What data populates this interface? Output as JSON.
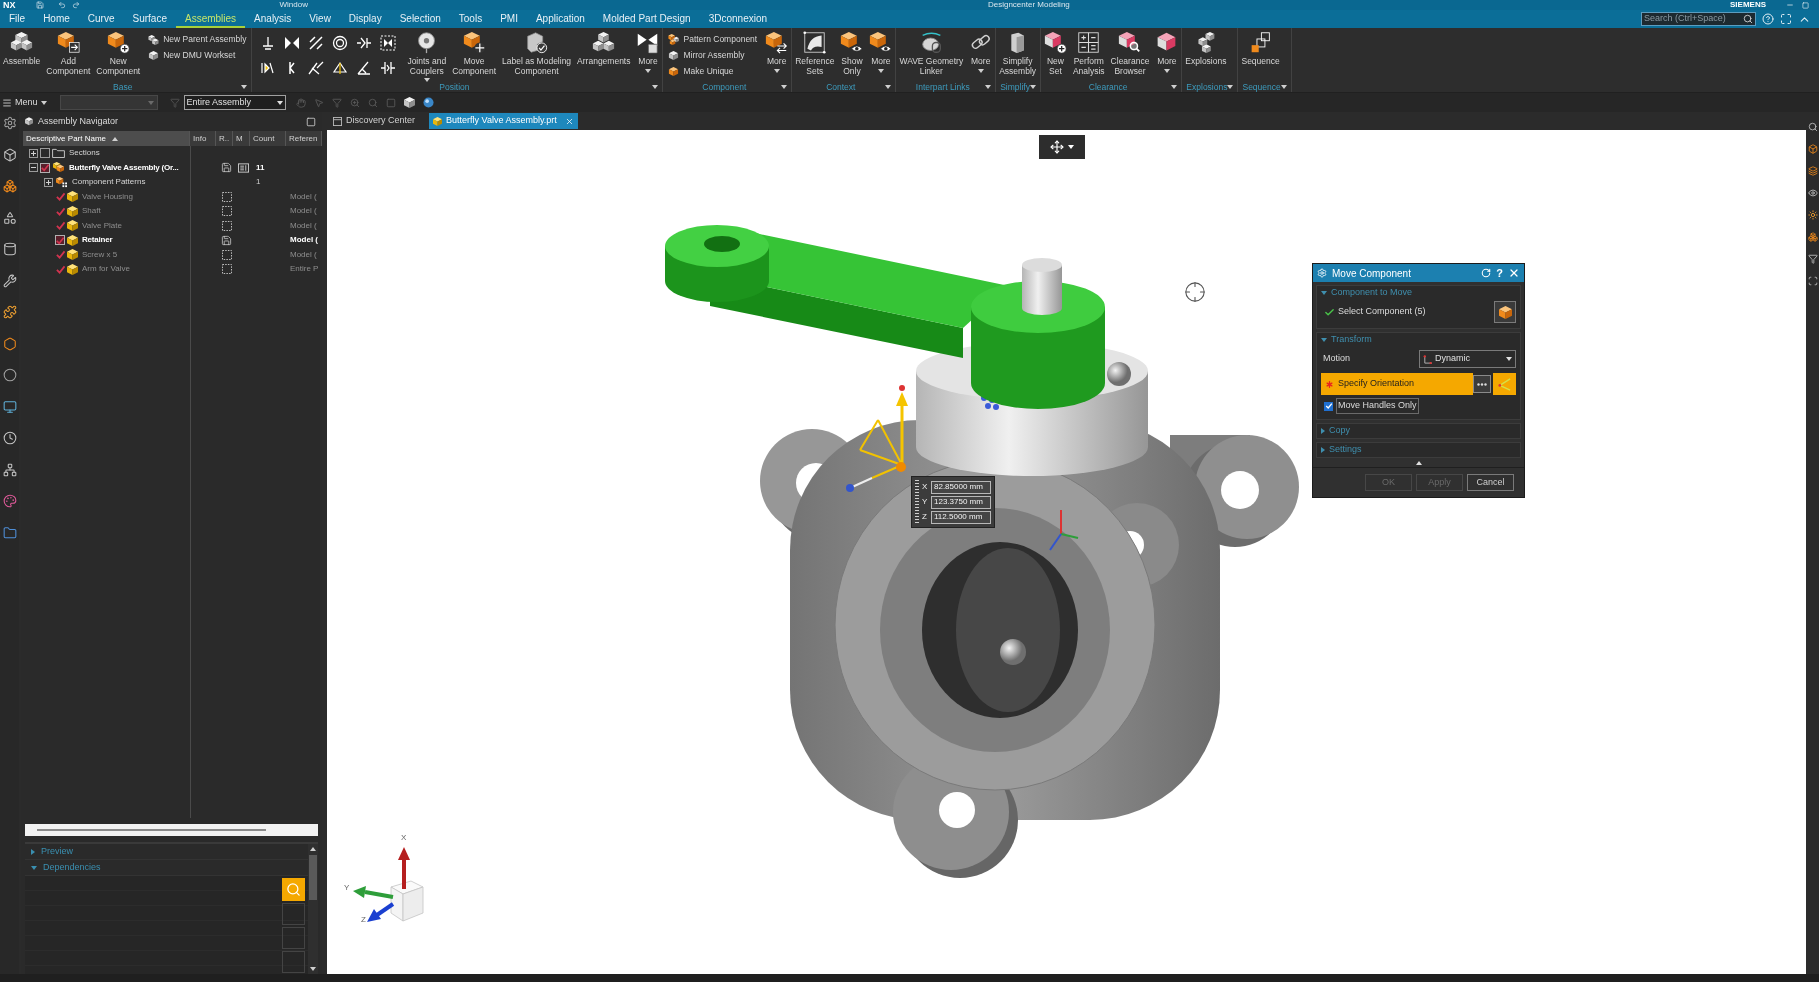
{
  "title_bar": {
    "logo": "NX",
    "menu": "Window",
    "title": "Designcenter Modeling",
    "brand": "SIEMENS"
  },
  "menu_tabs": [
    {
      "label": "File",
      "selected": false
    },
    {
      "label": "Home",
      "selected": false
    },
    {
      "label": "Curve",
      "selected": false
    },
    {
      "label": "Surface",
      "selected": false
    },
    {
      "label": "Assemblies",
      "selected": true
    },
    {
      "label": "Analysis",
      "selected": false
    },
    {
      "label": "View",
      "selected": false
    },
    {
      "label": "Display",
      "selected": false
    },
    {
      "label": "Selection",
      "selected": false
    },
    {
      "label": "Tools",
      "selected": false
    },
    {
      "label": "PMI",
      "selected": false
    },
    {
      "label": "Application",
      "selected": false
    },
    {
      "label": "Molded Part Design",
      "selected": false
    },
    {
      "label": "3Dconnexion",
      "selected": false
    }
  ],
  "search": {
    "placeholder": "Search (Ctrl+Space)"
  },
  "ribbon_groups": [
    {
      "label": "Base",
      "items": [
        {
          "kind": "large",
          "label": "Assemble",
          "dropdown": false
        },
        {
          "kind": "large",
          "label": "Add\nComponent",
          "dropdown": false
        },
        {
          "kind": "large",
          "label": "New\nComponent",
          "dropdown": false
        },
        {
          "kind": "stack",
          "entries": [
            "New Parent Assembly",
            "New DMU Workset"
          ]
        }
      ]
    },
    {
      "label": "Position",
      "items": [
        {
          "kind": "grid"
        },
        {
          "kind": "large",
          "label": "Joints and\nCouplers",
          "dropdown": true
        },
        {
          "kind": "large",
          "label": "Move\nComponent",
          "dropdown": false
        },
        {
          "kind": "large",
          "label": "Label as Modeling\nComponent",
          "dropdown": false
        },
        {
          "kind": "large",
          "label": "Arrangements",
          "dropdown": false
        },
        {
          "kind": "large",
          "label": "More",
          "dropdown": true
        }
      ]
    },
    {
      "label": "Component",
      "items": [
        {
          "kind": "stack",
          "entries": [
            "Pattern Component",
            "Mirror Assembly",
            "Make Unique"
          ]
        },
        {
          "kind": "large",
          "label": "More",
          "dropdown": true
        }
      ]
    },
    {
      "label": "Context",
      "items": [
        {
          "kind": "large",
          "label": "Reference\nSets",
          "dropdown": false
        },
        {
          "kind": "large",
          "label": "Show\nOnly",
          "dropdown": false
        },
        {
          "kind": "large",
          "label": "More",
          "dropdown": true
        }
      ]
    },
    {
      "label": "Interpart Links",
      "items": [
        {
          "kind": "large",
          "label": "WAVE Geometry\nLinker",
          "dropdown": false
        },
        {
          "kind": "large",
          "label": "More",
          "dropdown": true
        }
      ]
    },
    {
      "label": "Simplify",
      "items": [
        {
          "kind": "large",
          "label": "Simplify\nAssembly",
          "dropdown": false
        }
      ]
    },
    {
      "label": "Clearance",
      "items": [
        {
          "kind": "large",
          "label": "New\nSet",
          "dropdown": false
        },
        {
          "kind": "large",
          "label": "Perform\nAnalysis",
          "dropdown": false
        },
        {
          "kind": "large",
          "label": "Clearance\nBrowser",
          "dropdown": false
        },
        {
          "kind": "large",
          "label": "More",
          "dropdown": true
        }
      ]
    },
    {
      "label": "Explosions",
      "items": [
        {
          "kind": "large",
          "label": "Explosions",
          "dropdown": false
        }
      ]
    },
    {
      "label": "Sequence",
      "items": [
        {
          "kind": "large",
          "label": "Sequence",
          "dropdown": false
        }
      ]
    }
  ],
  "toolbar": {
    "menu_label": "Menu",
    "scope": "Entire Assembly"
  },
  "navigator": {
    "title": "Assembly Navigator",
    "columns": [
      {
        "label": "Descriptive Part Name",
        "sorted": true
      },
      {
        "label": "Info",
        "sorted": false
      },
      {
        "label": "R..",
        "sorted": false
      },
      {
        "label": "M",
        "sorted": false
      },
      {
        "label": "Count",
        "sorted": false
      },
      {
        "label": "Referen",
        "sorted": false
      }
    ],
    "rows": [
      {
        "name": "Sections",
        "kind": "folder",
        "expanded": false,
        "checked": false
      },
      {
        "name": "Butterfly Valve Assembly (Or...",
        "kind": "assembly",
        "expanded": true,
        "checked": true,
        "loaded": true,
        "count": "11",
        "children": [
          {
            "name": "Component Patterns",
            "kind": "patterns",
            "expanded": false,
            "count": "1"
          },
          {
            "name": "Valve Housing",
            "kind": "part",
            "checked": true,
            "loaded": false,
            "reference": "Model ("
          },
          {
            "name": "Shaft",
            "kind": "part",
            "checked": true,
            "loaded": false,
            "reference": "Model ("
          },
          {
            "name": "Valve Plate",
            "kind": "part",
            "checked": true,
            "loaded": false,
            "reference": "Model ("
          },
          {
            "name": "Retainer",
            "kind": "part",
            "checked": true,
            "loaded": true,
            "reference": "Model ("
          },
          {
            "name": "Screw x 5",
            "kind": "part",
            "checked": true,
            "loaded": false,
            "reference": "Model ("
          },
          {
            "name": "Arm for Valve",
            "kind": "part",
            "checked": true,
            "loaded": false,
            "reference": "Entire P"
          }
        ]
      }
    ],
    "panels": [
      {
        "label": "Preview",
        "expanded": false
      },
      {
        "label": "Dependencies",
        "expanded": true
      }
    ]
  },
  "document_tabs": [
    {
      "label": "Discovery Center",
      "selected": false
    },
    {
      "label": "Butterfly Valve Assembly.prt",
      "selected": true
    }
  ],
  "viewport": {
    "coordinates": [
      {
        "axis": "X",
        "value": "82.85000 mm"
      },
      {
        "axis": "Y",
        "value": "123.3750 mm"
      },
      {
        "axis": "Z",
        "value": "112.5000 mm"
      }
    ],
    "triad_axes": [
      "X",
      "Y",
      "Z"
    ]
  },
  "dialog": {
    "title": "Move Component",
    "help_label": "?",
    "sections": [
      {
        "label": "Component to Move",
        "expanded": true,
        "rows": [
          {
            "kind": "select",
            "label": "Select Component (5)",
            "complete": true,
            "active": false
          }
        ]
      },
      {
        "label": "Transform",
        "expanded": true,
        "rows": [
          {
            "kind": "dropdown",
            "label": "Motion",
            "value": "Dynamic"
          },
          {
            "kind": "orientation",
            "label": "Specify Orientation",
            "complete": false,
            "active": true
          },
          {
            "kind": "checkbox",
            "label": "Move Handles Only",
            "checked": true
          }
        ]
      },
      {
        "label": "Copy",
        "expanded": false
      },
      {
        "label": "Settings",
        "expanded": false
      }
    ],
    "buttons": [
      {
        "label": "OK",
        "disabled": true
      },
      {
        "label": "Apply",
        "disabled": true
      },
      {
        "label": "Cancel",
        "disabled": false
      }
    ]
  }
}
